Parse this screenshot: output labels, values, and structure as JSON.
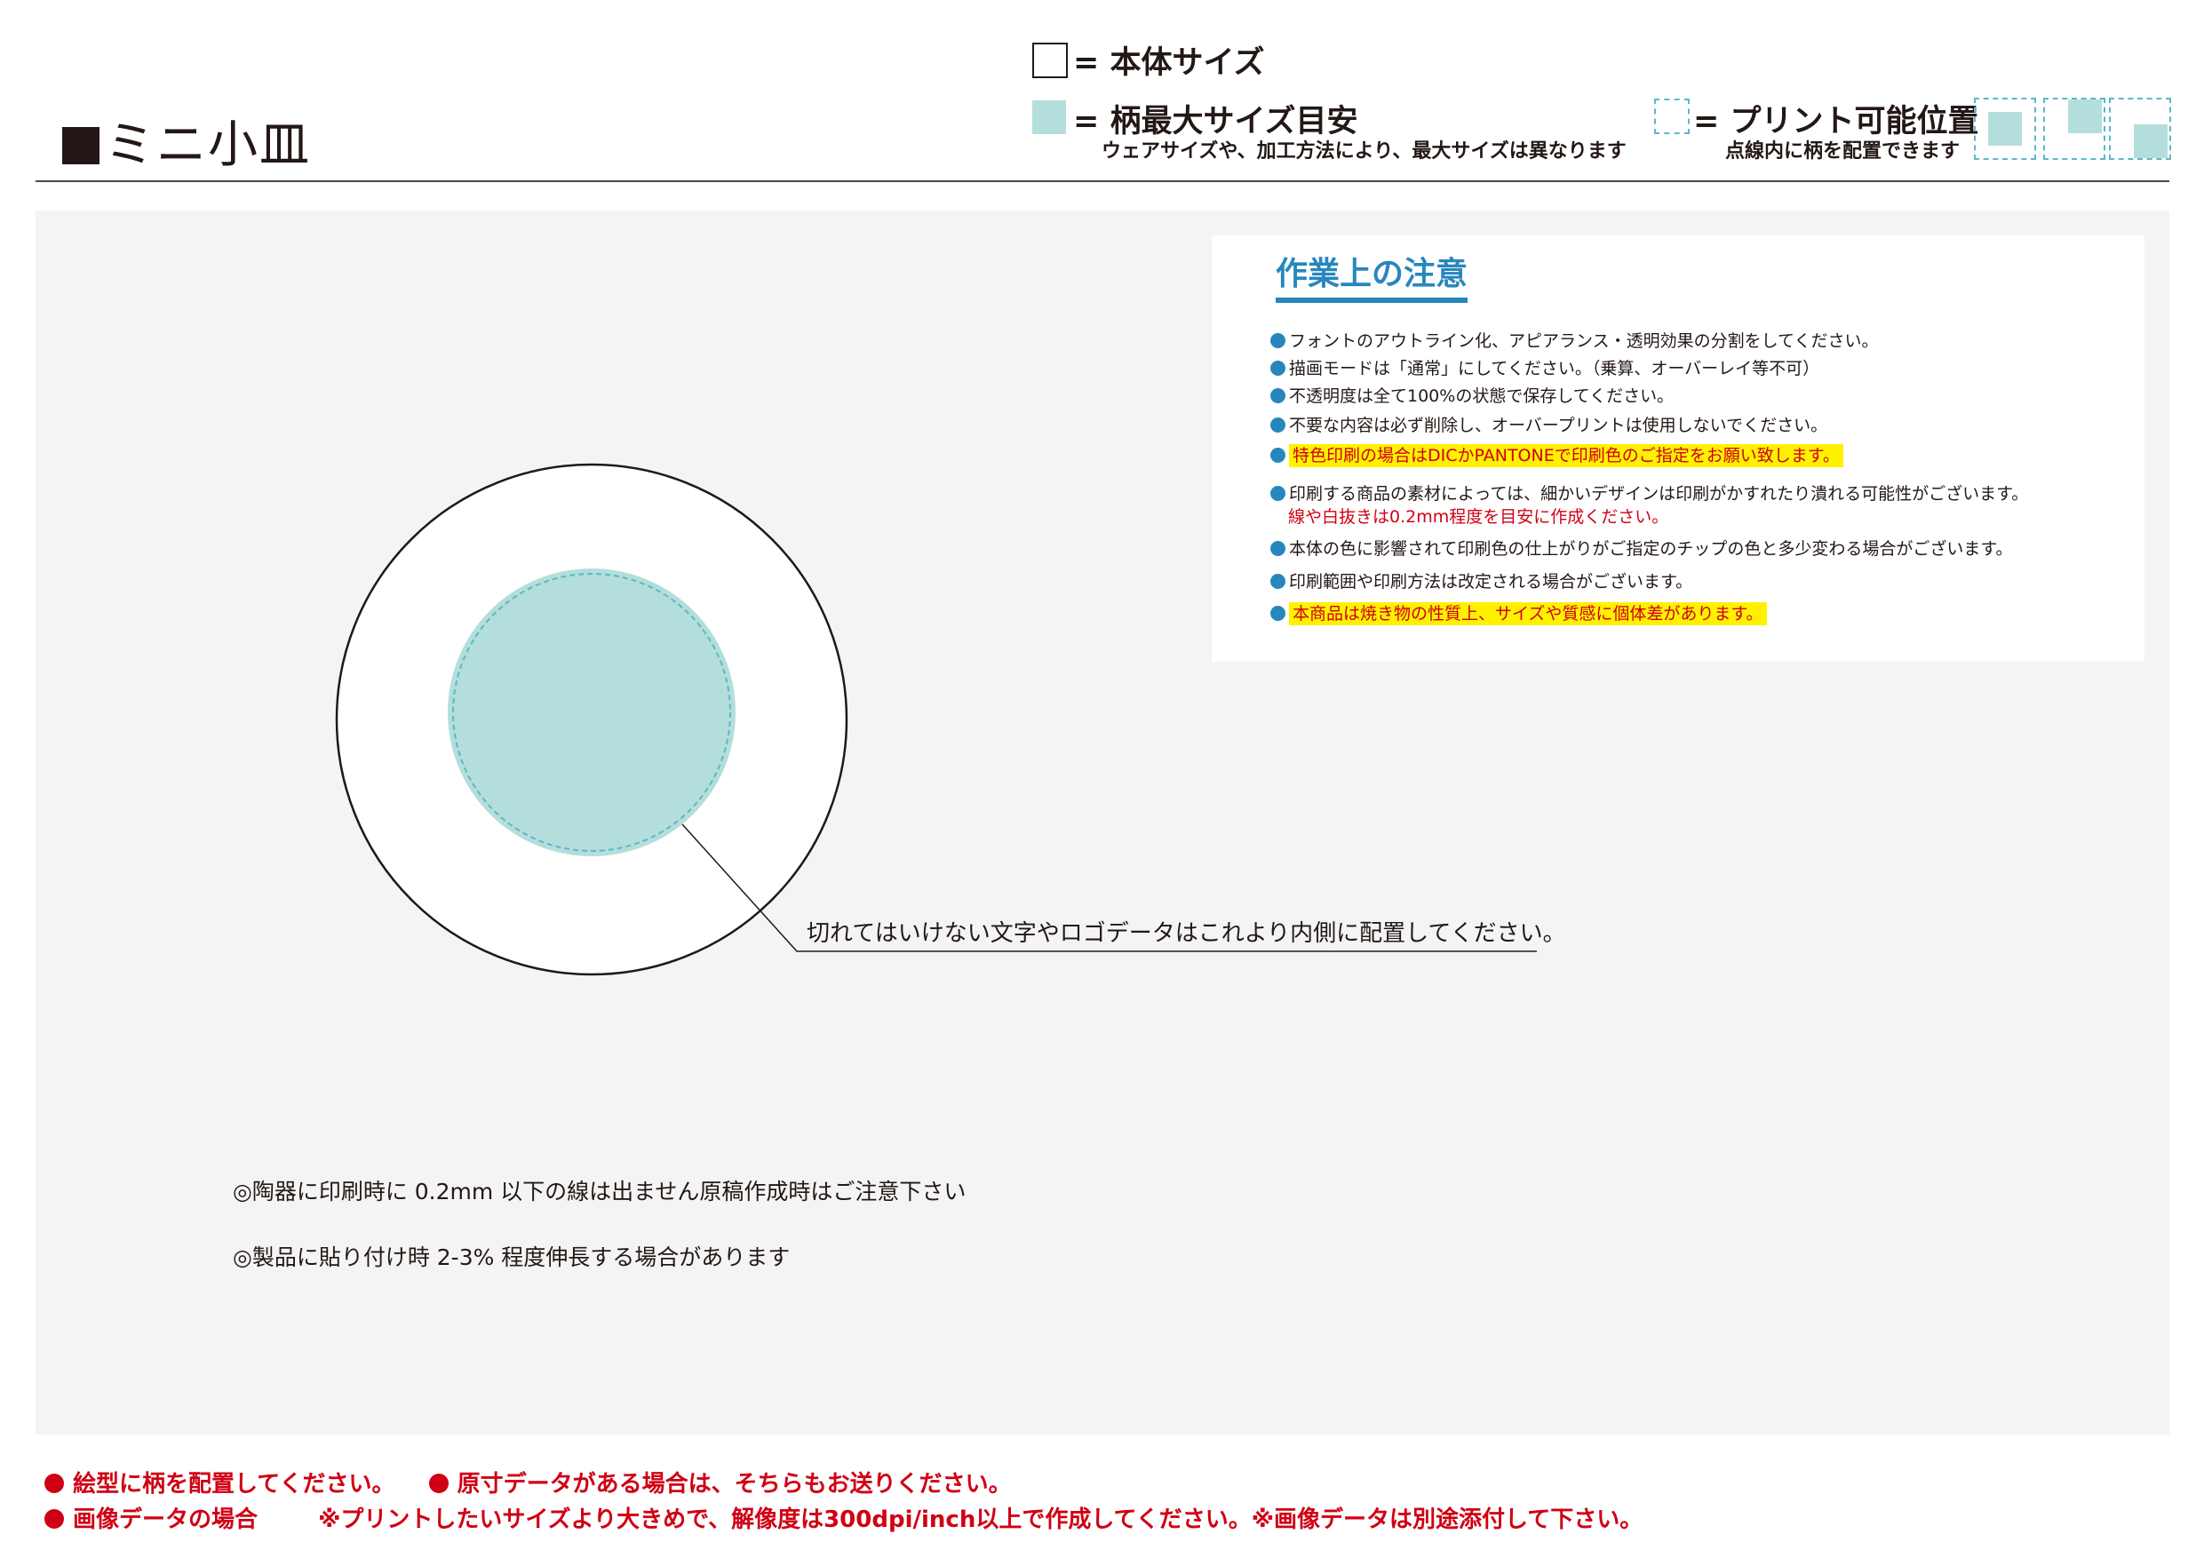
{
  "header": {
    "title": "ミニ小皿",
    "legend_body_size": "= 本体サイズ",
    "legend_max_pattern": "= 柄最大サイズ目安",
    "legend_max_pattern_note": "ウェアサイズや、加工方法により、最大サイズは異なります",
    "legend_print_position": "= プリント可能位置",
    "legend_print_position_note": "点線内に柄を配置できます"
  },
  "colors": {
    "teal_fill": "#b4dedb",
    "dash_blue": "#5bb8c4",
    "accent_blue": "#2787bd",
    "red": "#d00014",
    "highlight_yellow": "#fff100",
    "canvas_gray": "#f4f4f4"
  },
  "notes": {
    "title": "作業上の注意",
    "items": [
      "フォントのアウトライン化、アピアランス・透明効果の分割をしてください。",
      "描画モードは「通常」にしてください。（乗算、オーバーレイ等不可）",
      "不透明度は全て100%の状態で保存してください。",
      "不要な内容は必ず削除し、オーバープリントは使用しないでください。",
      "特色印刷の場合はDICかPANTONEで印刷色のご指定をお願い致します。",
      "印刷する商品の素材によっては、細かいデザインは印刷がかすれたり潰れる可能性がございます。",
      "本体の色に影響されて印刷色の仕上がりがご指定のチップの色と多少変わる場合がございます。",
      "印刷範囲や印刷方法は改定される場合がございます。",
      "本商品は焼き物の性質上、サイズや質感に個体差があります。"
    ],
    "item6_sub": "線や白抜きは0.2mm程度を目安に作成ください。"
  },
  "diagram": {
    "callout": "切れてはいけない文字やロゴデータはこれより内側に配置してください。"
  },
  "footnotes": [
    "◎陶器に印刷時に 0.2mm 以下の線は出ません原稿作成時はご注意下さい",
    "◎製品に貼り付け時 2-3% 程度伸長する場合があります"
  ],
  "footer": {
    "line1_a": "絵型に柄を配置してください。",
    "line1_b": "原寸データがある場合は、そちらもお送りください。",
    "line2_a": "画像データの場合",
    "line2_b": "※プリントしたいサイズより大きめで、解像度は300dpi/inch以上で作成してください。※画像データは別途添付して下さい。"
  }
}
